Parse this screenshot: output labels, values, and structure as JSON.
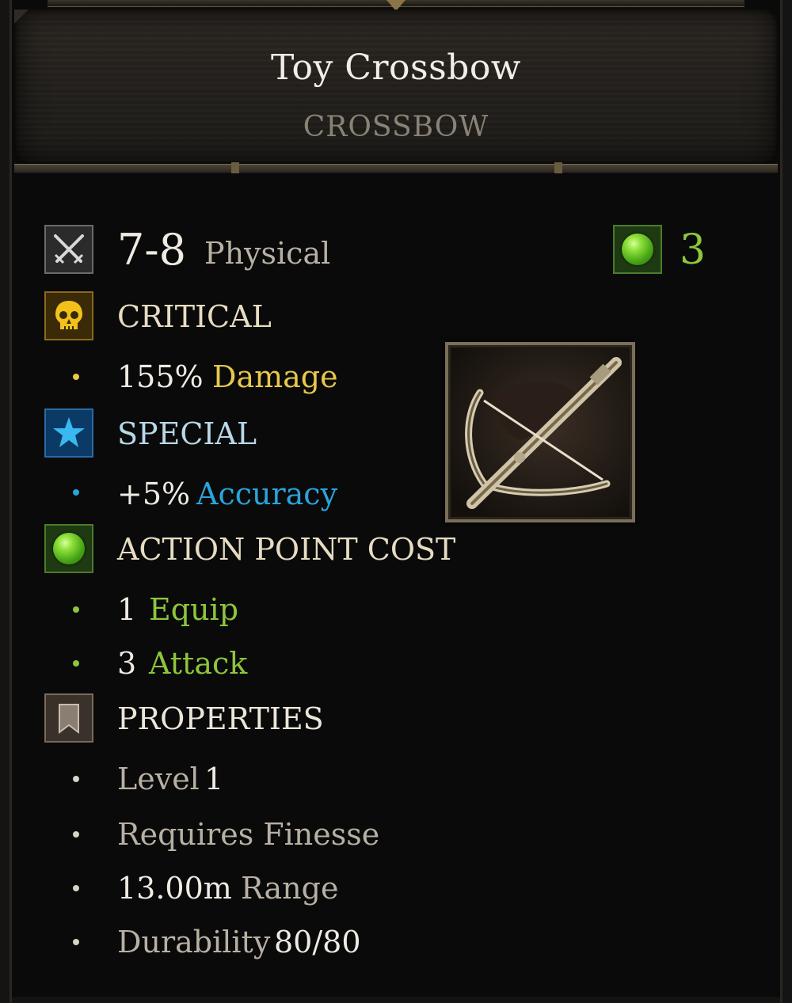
{
  "item": {
    "name": "Toy Crossbow",
    "type": "CROSSBOW"
  },
  "damage": {
    "range": "7-8",
    "type": "Physical",
    "icon": "crossed-swords-icon"
  },
  "ap_badge": {
    "value": "3",
    "icon": "green-gem-icon"
  },
  "critical": {
    "heading": "CRITICAL",
    "icon": "skull-icon",
    "value": "155%",
    "label": "Damage"
  },
  "special": {
    "heading": "SPECIAL",
    "icon": "star-icon",
    "value": "+5%",
    "label": "Accuracy"
  },
  "action_point_cost": {
    "heading": "ACTION POINT COST",
    "icon": "green-gem-icon",
    "items": [
      {
        "value": "1",
        "label": "Equip"
      },
      {
        "value": "3",
        "label": "Attack"
      }
    ]
  },
  "properties": {
    "heading": "PROPERTIES",
    "icon": "bookmark-icon",
    "level_label": "Level",
    "level_value": "1",
    "requires": "Requires Finesse",
    "range_value": "13.00m",
    "range_label": "Range",
    "durability_label": "Durability",
    "durability_value": "80/80"
  },
  "item_image": "crossbow-icon",
  "colors": {
    "critical": "#e8c84a",
    "special": "#2aa4dc",
    "ap": "#8cc63c",
    "text": "#efebe3",
    "muted": "#b8b0a4"
  }
}
